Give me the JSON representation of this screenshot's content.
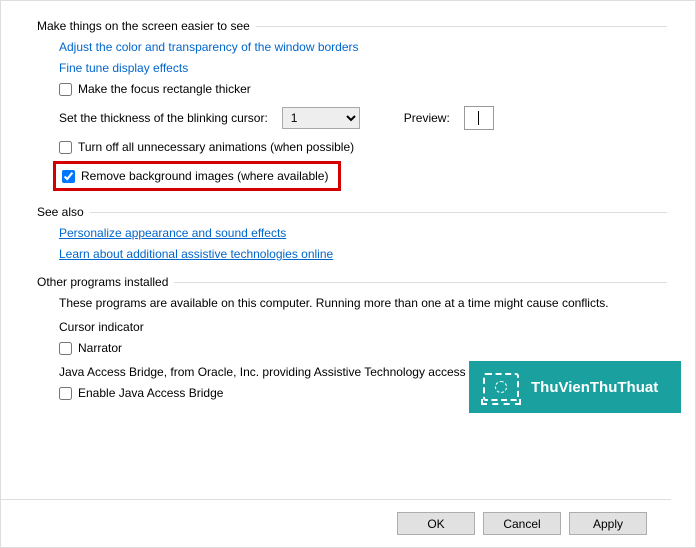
{
  "section1": {
    "title": "Make things on the screen easier to see",
    "link_color_transparency": "Adjust the color and transparency of the window borders",
    "link_fine_tune": "Fine tune display effects",
    "cb_focus_rect": "Make the focus rectangle thicker",
    "cursor_thickness_label": "Set the thickness of the blinking cursor:",
    "cursor_value": "1",
    "preview_label": "Preview:",
    "cb_animations": "Turn off all unnecessary animations (when possible)",
    "cb_remove_bg": "Remove background images (where available)"
  },
  "section2": {
    "title": "See also",
    "link_personalize": "Personalize appearance and sound effects",
    "link_learn": "Learn about additional assistive technologies online"
  },
  "section3": {
    "title": "Other programs installed",
    "desc": "These programs are available on this computer. Running more than one at a time might cause conflicts.",
    "cursor_indicator": "Cursor indicator",
    "cb_narrator": "Narrator",
    "java_desc": "Java Access Bridge, from Oracle, Inc. providing Assistive Technology access to Java applications",
    "cb_java": "Enable Java Access Bridge"
  },
  "buttons": {
    "ok": "OK",
    "cancel": "Cancel",
    "apply": "Apply"
  },
  "watermark": "ThuVienThuThuat"
}
